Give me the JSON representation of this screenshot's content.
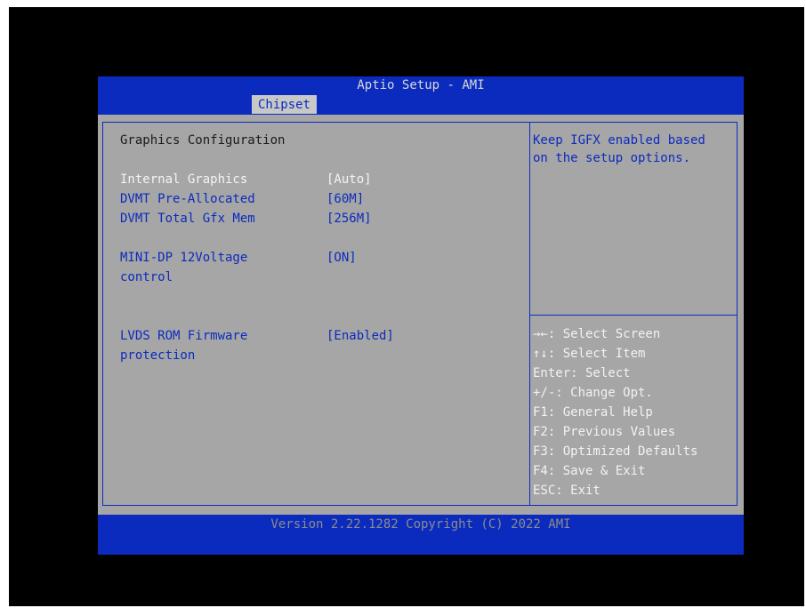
{
  "header": {
    "title": "Aptio Setup - AMI",
    "active_tab": "Chipset"
  },
  "main": {
    "section_title": "Graphics Configuration",
    "settings": [
      {
        "label": "Internal Graphics",
        "value": "[Auto]"
      },
      {
        "label": "DVMT Pre-Allocated",
        "value": "[60M]"
      },
      {
        "label": "DVMT Total Gfx Mem",
        "value": "[256M]"
      },
      {
        "label": "MINI-DP 12Voltage",
        "label2": "control",
        "value": "[ON]"
      },
      {
        "label": "LVDS ROM Firmware",
        "label2": "protection",
        "value": "[Enabled]"
      }
    ]
  },
  "help": {
    "description_line1": "Keep IGFX enabled based",
    "description_line2": "on the setup options.",
    "keys": [
      "→←: Select Screen",
      "↑↓: Select Item",
      "Enter: Select",
      "+/-: Change Opt.",
      "F1: General Help",
      "F2: Previous Values",
      "F3: Optimized Defaults",
      "F4: Save & Exit",
      "ESC: Exit"
    ]
  },
  "footer": {
    "version": "Version 2.22.1282 Copyright (C) 2022 AMI"
  },
  "colors": {
    "frame_blue": "#0b2bbe",
    "panel_gray": "#a6a6a6",
    "selected_text": "#f4f4f4"
  }
}
